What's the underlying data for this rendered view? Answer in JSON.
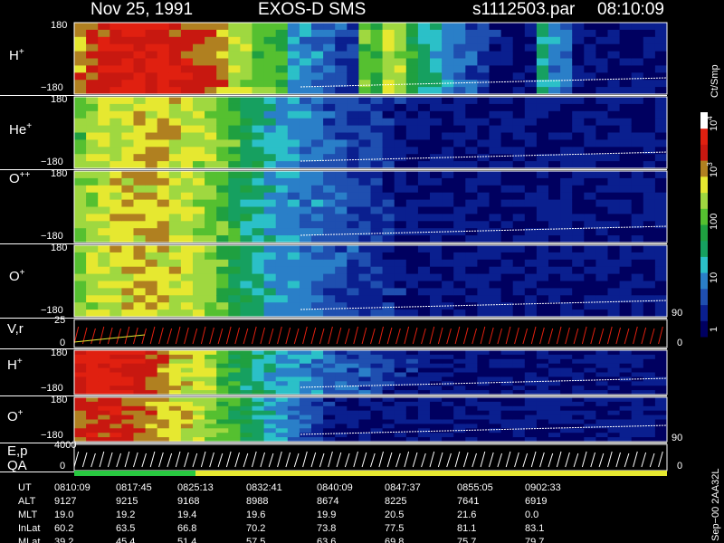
{
  "header": {
    "date": "Nov 25, 1991",
    "instrument": "EXOS-D SMS",
    "file": "s1112503.par",
    "time": "08:10:09"
  },
  "colors": {
    "background": "#000000",
    "spectrogram_scale": [
      "#000060",
      "#0a1f8f",
      "#1f4fb0",
      "#2a7fc8",
      "#2bc0c8",
      "#16a060",
      "#1fa040",
      "#55c030",
      "#9fd840",
      "#e6e830",
      "#b08020",
      "#c81810",
      "#e02010",
      "#ffffff"
    ]
  },
  "chart_data": [
    {
      "type": "heatmap",
      "panel": "H+ (upper)",
      "label_species": "H",
      "label_charge": "+",
      "ylim": [
        -180,
        180
      ],
      "ytick_top": "180",
      "ytick_bottom": "−180",
      "count_rate_profile": [
        80,
        85,
        90,
        92,
        95,
        94,
        93,
        92,
        90,
        88,
        86,
        85,
        82,
        70,
        65,
        60,
        55,
        50,
        30,
        28,
        25,
        20,
        18,
        15,
        60,
        55,
        70,
        65,
        50,
        40,
        35,
        30,
        25,
        20,
        15,
        10,
        8,
        8,
        8,
        40,
        30,
        25,
        8,
        8,
        8,
        8,
        8,
        8,
        8,
        8
      ]
    },
    {
      "type": "heatmap",
      "panel": "He+",
      "label_species": "He",
      "label_charge": "+",
      "ylim": [
        -180,
        180
      ],
      "ytick_top": "180",
      "ytick_bottom": "−180",
      "count_rate_profile": [
        60,
        65,
        70,
        72,
        74,
        75,
        75,
        74,
        72,
        70,
        68,
        66,
        62,
        55,
        45,
        40,
        35,
        30,
        28,
        26,
        24,
        22,
        20,
        18,
        16,
        14,
        12,
        10,
        8,
        8,
        8,
        8,
        8,
        8,
        8,
        8,
        8,
        8,
        8,
        8,
        8,
        8,
        8,
        8,
        8,
        8,
        8,
        8,
        8,
        8
      ]
    },
    {
      "type": "heatmap",
      "panel": "O++",
      "label_species": "O",
      "label_charge": "++",
      "ylim": [
        -180,
        180
      ],
      "ytick_top": "180",
      "ytick_bottom": "−180",
      "count_rate_profile": [
        62,
        66,
        70,
        72,
        74,
        75,
        75,
        74,
        72,
        70,
        66,
        62,
        58,
        50,
        42,
        38,
        34,
        30,
        28,
        26,
        24,
        22,
        20,
        18,
        16,
        14,
        12,
        10,
        8,
        8,
        8,
        8,
        8,
        8,
        8,
        8,
        8,
        8,
        8,
        8,
        8,
        8,
        8,
        8,
        8,
        8,
        8,
        8,
        8,
        8
      ]
    },
    {
      "type": "heatmap",
      "panel": "O+",
      "label_species": "O",
      "label_charge": "+",
      "ylim": [
        -180,
        180
      ],
      "ytick_top": "180",
      "ytick_bottom": "−180",
      "count_rate_profile": [
        62,
        66,
        70,
        72,
        74,
        75,
        75,
        74,
        72,
        70,
        66,
        62,
        58,
        50,
        42,
        38,
        34,
        30,
        28,
        26,
        24,
        22,
        20,
        18,
        16,
        14,
        12,
        10,
        8,
        8,
        8,
        8,
        8,
        8,
        8,
        8,
        8,
        8,
        8,
        8,
        8,
        8,
        8,
        8,
        8,
        8,
        8,
        8,
        8,
        8
      ]
    },
    {
      "type": "line",
      "panel": "V,r",
      "label": "V,r",
      "ytick_top": "25",
      "ytick_bottom": "0",
      "right_top": "90",
      "right_bottom": "0"
    },
    {
      "type": "heatmap",
      "panel": "H+ (lower)",
      "label_species": "H",
      "label_charge": "+",
      "ylim": [
        -180,
        180
      ],
      "ytick_top": "180",
      "ytick_bottom": "−180",
      "count_rate_profile": [
        92,
        95,
        96,
        95,
        93,
        90,
        85,
        80,
        75,
        72,
        70,
        65,
        55,
        48,
        45,
        40,
        35,
        32,
        30,
        28,
        26,
        24,
        22,
        20,
        18,
        16,
        14,
        12,
        10,
        8,
        8,
        8,
        8,
        8,
        8,
        8,
        8,
        8,
        8,
        8,
        8,
        8,
        8,
        8,
        8,
        8,
        8,
        8,
        8,
        8
      ]
    },
    {
      "type": "heatmap",
      "panel": "O+ (lower)",
      "label_species": "O",
      "label_charge": "+",
      "ylim": [
        -180,
        180
      ],
      "ytick_top": "180",
      "ytick_bottom": "−180",
      "count_rate_profile": [
        85,
        88,
        90,
        88,
        85,
        82,
        80,
        76,
        74,
        72,
        68,
        60,
        55,
        50,
        45,
        40,
        35,
        30,
        25,
        20,
        15,
        10,
        8,
        8,
        8,
        8,
        8,
        8,
        8,
        8,
        8,
        8,
        8,
        8,
        8,
        8,
        8,
        8,
        8,
        8,
        8,
        8,
        8,
        8,
        8,
        8,
        8,
        8,
        8,
        8
      ]
    },
    {
      "type": "line",
      "panel": "E,p QA",
      "label_top": "E,p",
      "label_bottom": "QA",
      "ytick_top": "4000",
      "ytick_bottom": "0",
      "right_top": "90",
      "right_bottom": "0"
    }
  ],
  "colorbar": {
    "unit": "Ct/Smp",
    "labels": [
      {
        "base": "10",
        "exp": "4"
      },
      {
        "base": "10",
        "exp": "3"
      },
      {
        "base": "100",
        "exp": ""
      },
      {
        "base": "10",
        "exp": ""
      },
      {
        "base": "1",
        "exp": ""
      }
    ]
  },
  "footer_label": "Sep−00  2AA32L",
  "table": {
    "rows": [
      {
        "name": "UT",
        "values": [
          "0810:09",
          "0817:45",
          "0825:13",
          "0832:41",
          "0840:09",
          "0847:37",
          "0855:05",
          "0902:33"
        ]
      },
      {
        "name": "ALT",
        "values": [
          "9127",
          "9215",
          "9168",
          "8988",
          "8674",
          "8225",
          "7641",
          "6919"
        ]
      },
      {
        "name": "MLT",
        "values": [
          "19.0",
          "19.2",
          "19.4",
          "19.6",
          "19.9",
          "20.5",
          "21.6",
          "0.0"
        ]
      },
      {
        "name": "InLat",
        "values": [
          "60.2",
          "63.5",
          "66.8",
          "70.2",
          "73.8",
          "77.5",
          "81.1",
          "83.1"
        ]
      },
      {
        "name": "MLat",
        "values": [
          "39.2",
          "45.4",
          "51.4",
          "57.5",
          "63.6",
          "69.8",
          "75.7",
          "79.7"
        ]
      }
    ]
  }
}
